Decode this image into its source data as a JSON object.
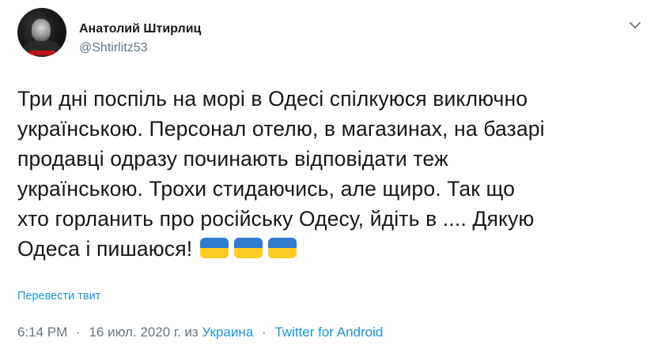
{
  "user": {
    "name": "Анатолий Штирлиц",
    "handle": "@Shtirlitz53"
  },
  "tweet": {
    "lines": [
      "Три дні поспіль на морі в Одесі спілкуюся виключно",
      "українською. Персонал отелю, в магазинах, на базарі",
      "продавці одразу починають відповідати теж",
      "українською. Трохи стидаючись, але щиро. Так що",
      "хто горланить про російську Одесу, йдіть в .... Дякую",
      "Одеса і пишаюся!"
    ],
    "emoji": [
      "ukraine-flag",
      "ukraine-flag",
      "ukraine-flag"
    ]
  },
  "translate_label": "Перевести твит",
  "meta": {
    "time": "6:14 PM",
    "separator": "·",
    "date": "16 июл. 2020 г. из",
    "location": "Украина",
    "source": "Twitter for Android"
  },
  "colors": {
    "link": "#1b95e0",
    "secondary_text": "#657786",
    "flag_blue": "#2f7bd0",
    "flag_yellow": "#ffcc1f"
  },
  "icons": {
    "menu": "chevron-down-icon"
  }
}
